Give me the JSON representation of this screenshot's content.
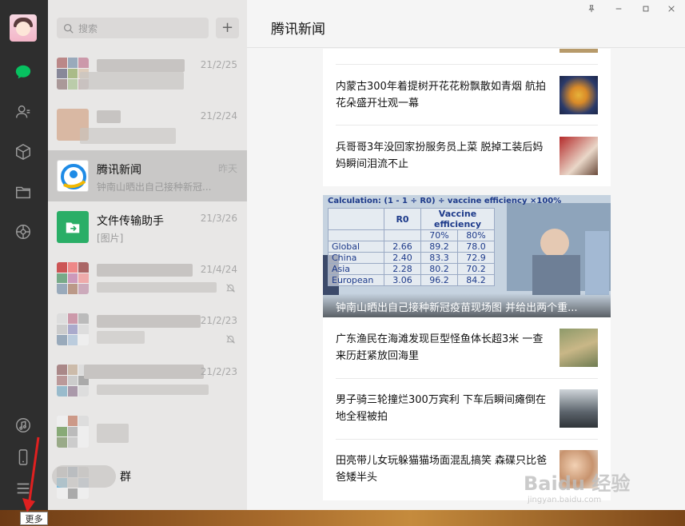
{
  "sidebar": {
    "icons": [
      "chat-icon",
      "contacts-icon",
      "favorites-icon",
      "files-icon",
      "moments-icon",
      "channels-icon",
      "phone-icon",
      "menu-icon"
    ],
    "accent": "#07c160"
  },
  "search": {
    "placeholder": "搜索",
    "add_label": "+"
  },
  "chats": [
    {
      "name": "",
      "preview": "",
      "time": "21/2/25",
      "blurred": true,
      "muted": false
    },
    {
      "name": "",
      "preview": "",
      "time": "21/2/24",
      "blurred": true,
      "muted": false
    },
    {
      "name": "腾讯新闻",
      "preview": "钟南山晒出自己接种新冠...",
      "time": "昨天",
      "blurred": false,
      "muted": false,
      "selected": true
    },
    {
      "name": "文件传输助手",
      "preview": "[图片]",
      "time": "21/3/26",
      "blurred": false,
      "muted": false
    },
    {
      "name": "",
      "preview": "",
      "time": "21/4/24",
      "blurred": true,
      "muted": true
    },
    {
      "name": "",
      "preview": "",
      "time": "21/2/23",
      "blurred": true,
      "muted": true
    },
    {
      "name": "",
      "preview": "",
      "time": "21/2/23",
      "blurred": true,
      "muted": false
    },
    {
      "name": "",
      "preview": "",
      "time": "",
      "blurred": true,
      "muted": false
    },
    {
      "name": "群",
      "preview": "",
      "time": "",
      "blurred": true,
      "muted": false
    }
  ],
  "main": {
    "title": "腾讯新闻",
    "window_controls": [
      "pin-icon",
      "minimize-icon",
      "maximize-icon",
      "close-icon"
    ],
    "articles_top": [
      {
        "title": "内蒙古300年着提树开花花粉飘散如青烟 航拍花朵盛开壮观一幕"
      },
      {
        "title": "兵哥哥3年没回家扮服务员上菜 脱掉工装后妈妈瞬间泪流不止"
      }
    ],
    "hero": {
      "caption": "钟南山晒出自己接种新冠疫苗现场图 并给出两个重...",
      "table_title": "Calculation: (1 - 1 ÷ R0) ÷ vaccine efficiency ×100%",
      "headers": [
        "",
        "R0",
        "Vaccine efficiency"
      ],
      "subheaders": [
        "",
        "",
        "70%",
        "80%"
      ],
      "rows": [
        [
          "Global",
          "2.66",
          "89.2",
          "78.0"
        ],
        [
          "China",
          "2.40",
          "83.3",
          "72.9"
        ],
        [
          "Asia",
          "2.28",
          "80.2",
          "70.2"
        ],
        [
          "European",
          "3.06",
          "96.2",
          "84.2"
        ]
      ]
    },
    "articles_bottom": [
      {
        "title": "广东渔民在海滩发现巨型怪鱼体长超3米 一查来历赶紧放回海里"
      },
      {
        "title": "男子骑三轮撞烂300万宾利 下车后瞬间瘫倒在地全程被拍"
      },
      {
        "title": "田亮带儿女玩躲猫猫场面混乱搞笑 森碟只比爸爸矮半头"
      }
    ]
  },
  "tooltip": "更多",
  "watermark": {
    "brand": "Baidu 经验",
    "url": "jingyan.baidu.com"
  }
}
